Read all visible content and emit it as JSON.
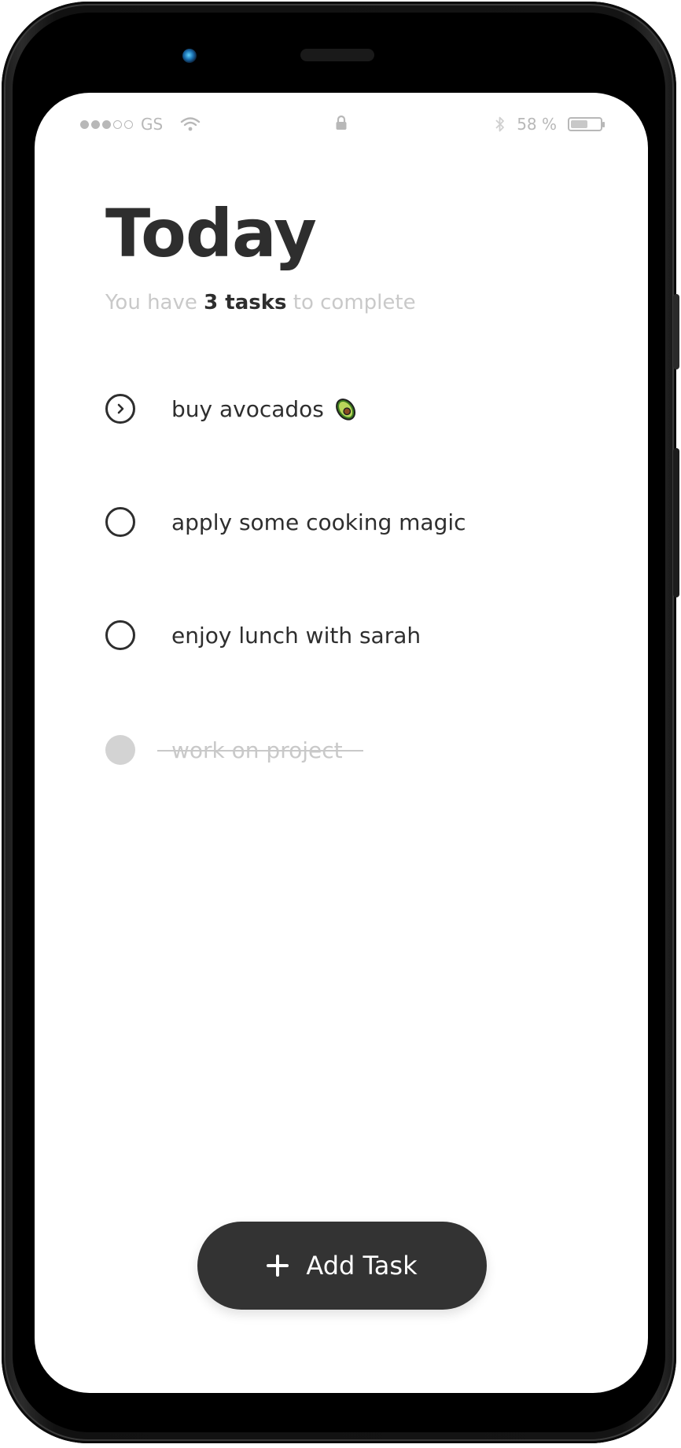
{
  "status_bar": {
    "carrier": "GS",
    "battery_text": "58 %",
    "battery_level": 0.58,
    "signal_bars_filled": 3,
    "signal_bars_total": 5,
    "icons": [
      "signal-dots-icon",
      "wifi-icon",
      "lock-icon",
      "bluetooth-icon",
      "battery-icon"
    ]
  },
  "header": {
    "title": "Today",
    "subtitle_prefix": "You have",
    "subtitle_count": "3 tasks",
    "subtitle_suffix": "to complete"
  },
  "tasks": [
    {
      "label": "buy avocados",
      "state": "active",
      "emoji_icon": "avocado-icon"
    },
    {
      "label": "apply some cooking magic",
      "state": "open"
    },
    {
      "label": "enjoy lunch with sarah",
      "state": "open"
    },
    {
      "label": "work on project",
      "state": "done"
    }
  ],
  "add_button": {
    "label": "Add Task",
    "icon": "plus-icon"
  },
  "colors": {
    "text_dark": "#2e2e2e",
    "text_muted": "#c9c9c9",
    "button_bg": "#333333",
    "done_fill": "#d3d3d3"
  }
}
